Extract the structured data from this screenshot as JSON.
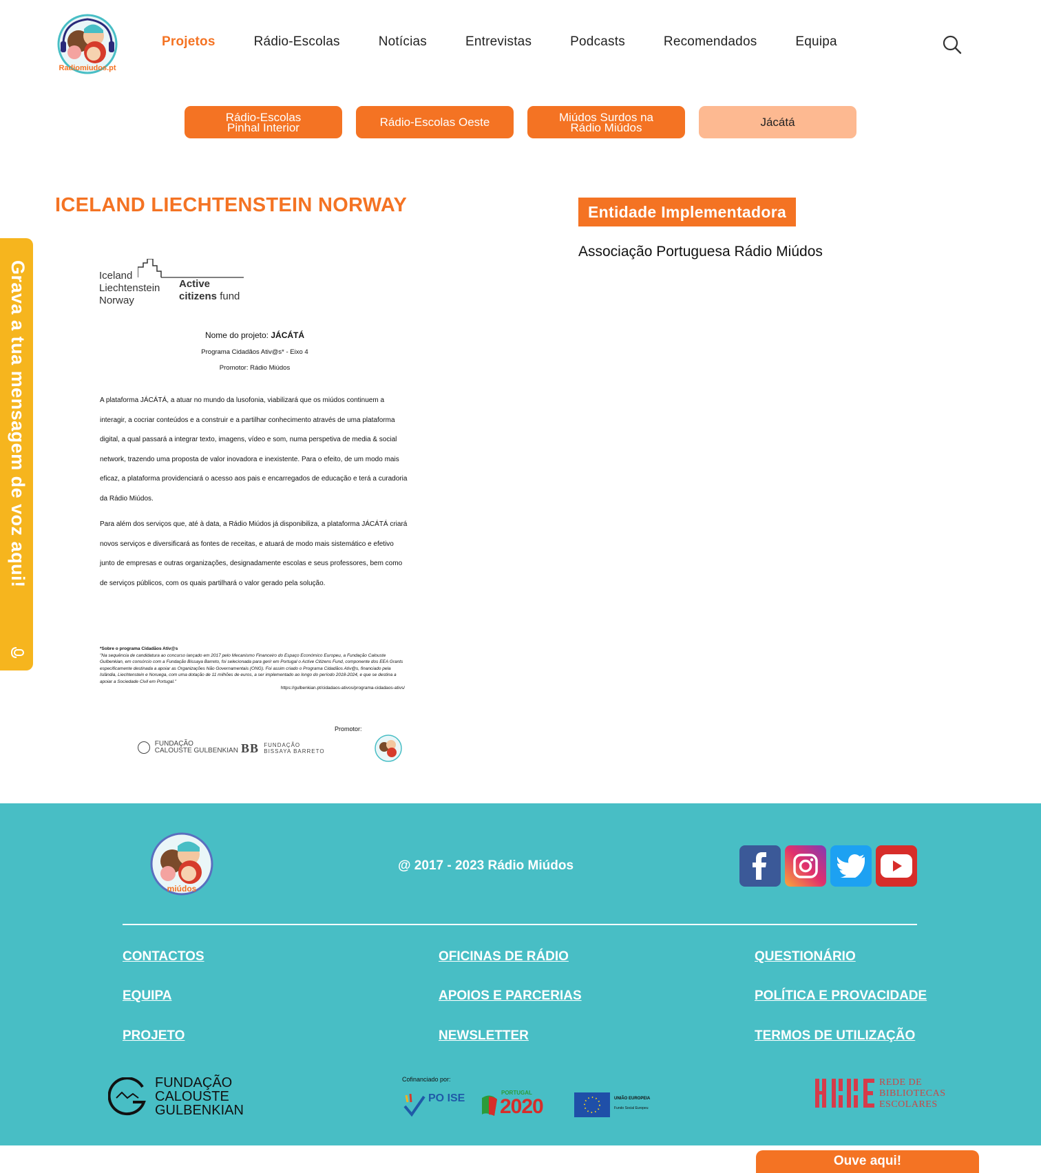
{
  "nav": {
    "items": [
      "Projetos",
      "Rádio-Escolas",
      "Notícias",
      "Entrevistas",
      "Podcasts",
      "Recomendados",
      "Equipa"
    ],
    "logo_text": "Radiomiudos.pt"
  },
  "subtabs": [
    {
      "label": "Rádio-Escolas\nPinhal Interior"
    },
    {
      "label": "Rádio-Escolas Oeste"
    },
    {
      "label": "Miúdos Surdos na\nRádio Miúdos"
    },
    {
      "label": "Jácátá"
    }
  ],
  "main": {
    "title": "ICELAND LIECHTENSTEIN NORWAY",
    "doc": {
      "logo_left": "Iceland\nLiechtenstein\nNorway",
      "logo_right_bold": "Active",
      "logo_right_line2_bold": "citizens",
      "logo_right_line2_rest": " fund",
      "project_name_prefix": "Nome do projeto: ",
      "project_name": "JÁCÁTÁ",
      "program": "Programa Cidadãos Ativ@s* - Eixo 4",
      "promoter": "Promotor: Rádio Miúdos",
      "para1": "A plataforma JÁCÁTÁ, a atuar no mundo da lusofonia, viabilizará que os miúdos continuem a interagir, a cocriar conteúdos e a construir e a partilhar conhecimento através de uma plataforma digital, a qual passará a integrar texto, imagens, vídeo e som, numa perspetiva de media & social network, trazendo uma proposta de valor inovadora e inexistente. Para o efeito, de um modo mais eficaz, a plataforma providenciará o acesso aos pais e encarregados de educação e terá a curadoria da Rádio Miúdos.",
      "para2": "Para além dos serviços que, até à data, a Rádio Miúdos já disponibiliza, a plataforma JÁCÁTÁ criará novos serviços e diversificará as fontes de receitas, e atuará de modo mais sistemático e efetivo junto de empresas e outras organizações, designadamente escolas e seus professores, bem como de serviços públicos, com os quais partilhará o valor gerado pela solução.",
      "footnote_title": "*Sobre o programa Cidadãos Ativ@s",
      "footnote_body": "\"Na sequência de candidatura ao concurso lançado em 2017 pelo Mecanismo Financeiro do Espaço Económico Europeu, a Fundação Calouste Gulbenkian, em consórcio com a Fundação Bissaya Barreto, foi selecionada para gerir em Portugal o Active Citizens Fund, componente dos EEA Grants especificamente destinada a apoiar as Organizações Não Governamentais (ONG). Foi assim criado o Programa Cidadãos Ativ@s, financiado pela Islândia, Liechtenstein e Noruega, com uma dotação de 11 milhões de euros, a ser implementado ao longo do período 2018-2024, e que se destina a apoiar a Sociedade Civil em Portugal.\"",
      "footnote_url": "https://gulbenkian.pt/cidadaos-ativos/programa-cidadaos-ativs/",
      "promotor_label": "Promotor:",
      "fcg_small": "FUNDAÇÃO\nCALOUSTE GULBENKIAN",
      "fbb_small": "FUNDAÇÃO\nBISSAYA BARRETO"
    }
  },
  "entity": {
    "badge": "Entidade Implementadora",
    "name": "Associação Portuguesa Rádio Miúdos"
  },
  "side_tab": {
    "label": "Grava a tua mensagem de voz aqui!"
  },
  "footer": {
    "copyright": "@ 2017 - 2023 Rádio Miúdos",
    "links_col1": [
      "CONTACTOS",
      "EQUIPA",
      "PROJETO"
    ],
    "links_col2": [
      "OFICINAS DE RÁDIO",
      "APOIOS E PARCERIAS",
      "NEWSLETTER"
    ],
    "links_col3": [
      "QUESTIONÁRIO",
      "POLÍTICA E PROVACIDADE",
      "TERMOS DE UTILIZAÇÃO"
    ],
    "fcg_logo": "FUNDAÇÃO\nCALOUSTE\nGULBENKIAN",
    "cofin_label": "Cofinanciado por:",
    "poise": "PO ISE",
    "p2020_small": "PORTUGAL",
    "p2020": "2020",
    "ue": "UNIÃO EUROPEIA",
    "ue_sub": "Fundo Social Europeu",
    "rbe": "REDE DE\nBIBLIOTECAS\nESCOLARES"
  },
  "listen": {
    "label": "Ouve aqui!"
  },
  "colors": {
    "accent": "#f47323",
    "accent_light": "#fdb991",
    "footer_bg": "#48bec5",
    "side_tab": "#f6b51e"
  }
}
